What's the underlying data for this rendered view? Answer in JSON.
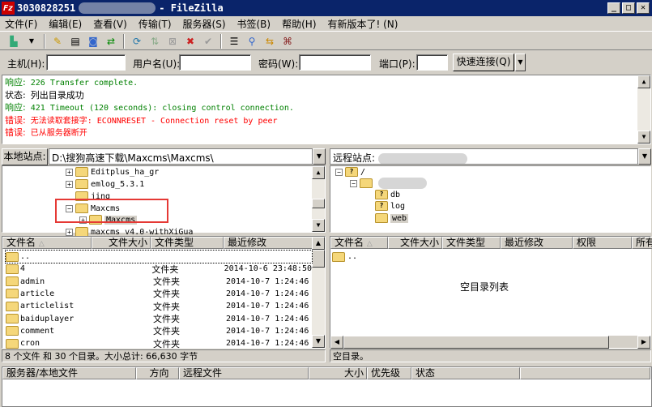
{
  "title": {
    "prefix": "3030828251",
    "suffix": "- FileZilla",
    "logo": "Fz"
  },
  "menu": [
    "文件(F)",
    "编辑(E)",
    "查看(V)",
    "传输(T)",
    "服务器(S)",
    "书签(B)",
    "帮助(H)",
    "有新版本了! (N)"
  ],
  "quickconnect": {
    "host_label": "主机(H):",
    "user_label": "用户名(U):",
    "pass_label": "密码(W):",
    "port_label": "端口(P):",
    "host": "",
    "user": "",
    "pass": "",
    "port": "",
    "connect_label": "快速连接(Q)"
  },
  "log": [
    {
      "prefix": "响应:",
      "text": "226 Transfer complete.",
      "type": "response"
    },
    {
      "prefix": "状态:",
      "text": "列出目录成功",
      "type": "status"
    },
    {
      "prefix": "响应:",
      "text": "421 Timeout (120 seconds): closing control connection.",
      "type": "response"
    },
    {
      "prefix": "错误:",
      "text": "无法读取套接字: ECONNRESET - Connection reset by peer",
      "type": "error"
    },
    {
      "prefix": "错误:",
      "text": "已从服务器断开",
      "type": "error"
    }
  ],
  "local": {
    "site_label": "本地站点:",
    "path": "D:\\搜狗高速下载\\Maxcms\\Maxcms\\",
    "tree": [
      "Editplus_ha_gr",
      "emlog_5.3.1",
      "jing",
      "Maxcms",
      "Maxcms",
      "maxcms_v4.0-withXiGua"
    ],
    "columns": [
      "文件名",
      "文件大小",
      "文件类型",
      "最近修改"
    ],
    "files": [
      {
        "name": "..",
        "type": "",
        "modified": ""
      },
      {
        "name": "4",
        "type": "文件夹",
        "modified": "2014-10-6 23:48:50"
      },
      {
        "name": "admin",
        "type": "文件夹",
        "modified": "2014-10-7 1:24:46"
      },
      {
        "name": "article",
        "type": "文件夹",
        "modified": "2014-10-7 1:24:46"
      },
      {
        "name": "articlelist",
        "type": "文件夹",
        "modified": "2014-10-7 1:24:46"
      },
      {
        "name": "baiduplayer",
        "type": "文件夹",
        "modified": "2014-10-7 1:24:46"
      },
      {
        "name": "comment",
        "type": "文件夹",
        "modified": "2014-10-7 1:24:46"
      },
      {
        "name": "cron",
        "type": "文件夹",
        "modified": "2014-10-7 1:24:46"
      }
    ],
    "status": "8 个文件 和 30 个目录。大小总计: 66,630 字节"
  },
  "remote": {
    "site_label": "远程站点:",
    "tree": [
      "/",
      "db",
      "log",
      "web"
    ],
    "columns": [
      "文件名",
      "文件大小",
      "文件类型",
      "最近修改",
      "权限",
      "所有"
    ],
    "files": [
      ".."
    ],
    "empty": "空目录列表",
    "status": "空目录。"
  },
  "queue": {
    "columns": [
      "服务器/本地文件",
      "方向",
      "远程文件",
      "大小",
      "优先级",
      "状态"
    ]
  }
}
